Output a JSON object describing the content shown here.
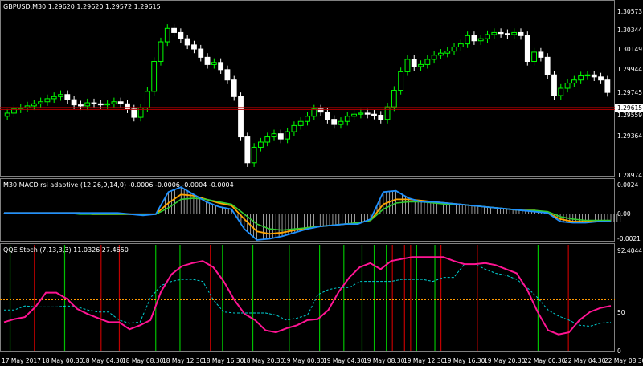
{
  "chart": {
    "title_label": "GBPUSD,M30  1.29620 1.29620 1.29572 1.29615",
    "current_price_tag": "1.29615",
    "price_axis": {
      "ticks": [
        "1.30573",
        "1.30344",
        "1.30149",
        "1.29944",
        "1.29745",
        "1.29559",
        "1.29364",
        "1.28974"
      ]
    }
  },
  "macd_panel": {
    "title_label": "M30 MACD rsi adaptive (12,26,9,14,0) -0.0006 -0.0006 -0.0004 -0.0004",
    "ticks": [
      "0.0024",
      "0.00",
      "-0.0021"
    ]
  },
  "qqe_panel": {
    "title_label": "QQE Stoch  (7,13,3,3) 11.0326 27.4650",
    "ticks": [
      "92.4044",
      "50",
      "0"
    ]
  },
  "time_axis": {
    "labels": [
      "17 May 2017",
      "18 May 00:30",
      "18 May 04:30",
      "18 May 08:30",
      "18 May 12:30",
      "18 May 16:30",
      "18 May 20:30",
      "19 May 00:30",
      "19 May 04:30",
      "19 May 08:30",
      "19 May 12:30",
      "19 May 16:30",
      "19 May 20:30",
      "22 May 00:30",
      "22 May 04:30",
      "22 May 08:30"
    ]
  },
  "colors": {
    "bull": "#00ff00",
    "bear": "#ffffff",
    "price_line": "#b00000",
    "macd_fast": "#1e90ff",
    "macd_slow": "#ffa500",
    "macd_signal": "#32cd32",
    "qqe_main": "#ff1493",
    "qqe_signal": "#00ced1",
    "qqe_level": "#ff9900",
    "green_marker": "#00c000",
    "red_marker": "#c00000"
  },
  "chart_data": {
    "type": "candlestick",
    "instrument": "GBPUSD",
    "timeframe": "M30",
    "close": [
      1.2958,
      1.2962,
      1.2963,
      1.2965,
      1.2967,
      1.2969,
      1.2972,
      1.2974,
      1.2976,
      1.2971,
      1.2966,
      1.2965,
      1.2968,
      1.2967,
      1.2966,
      1.2967,
      1.2969,
      1.2967,
      1.2962,
      1.2954,
      1.2963,
      1.2979,
      1.3008,
      1.3027,
      1.304,
      1.3036,
      1.303,
      1.3024,
      1.302,
      1.3012,
      1.3005,
      1.3007,
      1.3,
      1.299,
      1.2974,
      1.2935,
      1.291,
      1.2925,
      1.293,
      1.2935,
      1.2938,
      1.2933,
      1.294,
      1.2946,
      1.295,
      1.2955,
      1.2962,
      1.2959,
      1.2952,
      1.2947,
      1.295,
      1.2955,
      1.2957,
      1.2958,
      1.2957,
      1.2956,
      1.2952,
      1.2964,
      1.298,
      1.2998,
      1.301,
      1.3003,
      1.3005,
      1.301,
      1.3014,
      1.3016,
      1.3018,
      1.3022,
      1.3025,
      1.3033,
      1.3028,
      1.303,
      1.3034,
      1.3036,
      1.3035,
      1.3034,
      1.3036,
      1.3033,
      1.3008,
      1.3017,
      1.3012,
      1.2995,
      1.2975,
      1.2982,
      1.2987,
      1.299,
      1.2994,
      1.2995,
      1.2993,
      1.299,
      1.2978
    ],
    "qqe_main": [
      28,
      31,
      33,
      43,
      57,
      57,
      51,
      41,
      36,
      32,
      28,
      28,
      21,
      25,
      30,
      58,
      75,
      83,
      86,
      88,
      82,
      68,
      50,
      36,
      30,
      20,
      18,
      22,
      25,
      30,
      31,
      40,
      58,
      72,
      82,
      86,
      80,
      88,
      90,
      92,
      92,
      92,
      92,
      88,
      85,
      85,
      86,
      84,
      80,
      76,
      60,
      38,
      20,
      16,
      18,
      30,
      38,
      42,
      44
    ],
    "qqe_signal": [
      40,
      40,
      44,
      43,
      43,
      43,
      44,
      43,
      40,
      38,
      38,
      30,
      27,
      28,
      52,
      64,
      68,
      70,
      70,
      68,
      50,
      38,
      37,
      37,
      37,
      37,
      35,
      30,
      32,
      35,
      55,
      60,
      62,
      62,
      68,
      68,
      68,
      68,
      70,
      70,
      70,
      68,
      72,
      72,
      85,
      85,
      80,
      76,
      74,
      70,
      62,
      52,
      40,
      34,
      30,
      25,
      24,
      27,
      28
    ],
    "macd_fast": [
      0.0001,
      0.0001,
      0.0001,
      0.0001,
      0.0001,
      0.0001,
      0.0001,
      0.0001,
      0.0001,
      0.0001,
      0.0,
      -0.0001,
      0.0,
      0.0018,
      0.0022,
      0.0016,
      0.001,
      0.0006,
      0.0004,
      -0.0012,
      -0.0021,
      -0.002,
      -0.0018,
      -0.0015,
      -0.0012,
      -0.001,
      -0.0009,
      -0.0008,
      -0.0008,
      -0.0004,
      0.0018,
      0.0019,
      0.0013,
      0.001,
      0.001,
      0.0009,
      0.0008,
      0.0007,
      0.0006,
      0.0005,
      0.0004,
      0.0003,
      0.0002,
      0.0001,
      -0.0006,
      -0.0007,
      -0.0007,
      -0.0006,
      -0.0006
    ],
    "macd_slow": [
      0.0001,
      0.0001,
      0.0001,
      0.0001,
      0.0001,
      0.0001,
      0.0001,
      0.0,
      0.0,
      0.0,
      0.0,
      0.0,
      0.0,
      0.0009,
      0.0016,
      0.0015,
      0.0012,
      0.0009,
      0.0007,
      -0.0004,
      -0.0014,
      -0.0016,
      -0.0015,
      -0.0013,
      -0.0011,
      -0.001,
      -0.0009,
      -0.0008,
      -0.0007,
      -0.0005,
      0.0008,
      0.0012,
      0.0012,
      0.0011,
      0.001,
      0.0009,
      0.0008,
      0.0007,
      0.0006,
      0.0005,
      0.0004,
      0.0003,
      0.0003,
      0.0001,
      -0.0004,
      -0.0006,
      -0.0006,
      -0.0006,
      -0.0006
    ],
    "macd_signal_line": [
      0.0001,
      0.0001,
      0.0001,
      0.0001,
      0.0001,
      0.0001,
      0.0,
      0.0,
      0.0,
      0.0,
      0.0,
      0.0,
      0.0,
      0.0005,
      0.0012,
      0.0013,
      0.0012,
      0.001,
      0.0008,
      0.0,
      -0.0008,
      -0.0012,
      -0.0013,
      -0.0012,
      -0.0011,
      -0.001,
      -0.0009,
      -0.0008,
      -0.0007,
      -0.0005,
      0.0004,
      0.0009,
      0.001,
      0.001,
      0.0009,
      0.0008,
      0.0008,
      0.0007,
      0.0006,
      0.0005,
      0.0004,
      0.0003,
      0.0003,
      0.0002,
      -0.0002,
      -0.0004,
      -0.0005,
      -0.0005,
      -0.0005
    ],
    "qqe_levels": [
      50
    ],
    "green_markers": [
      1,
      10,
      25,
      29,
      36,
      41,
      47,
      52,
      56,
      59,
      61,
      63,
      68,
      71,
      88
    ],
    "red_markers": [
      5,
      16,
      19,
      34,
      64,
      66,
      67,
      72,
      78,
      93
    ],
    "markers_count": 100
  }
}
